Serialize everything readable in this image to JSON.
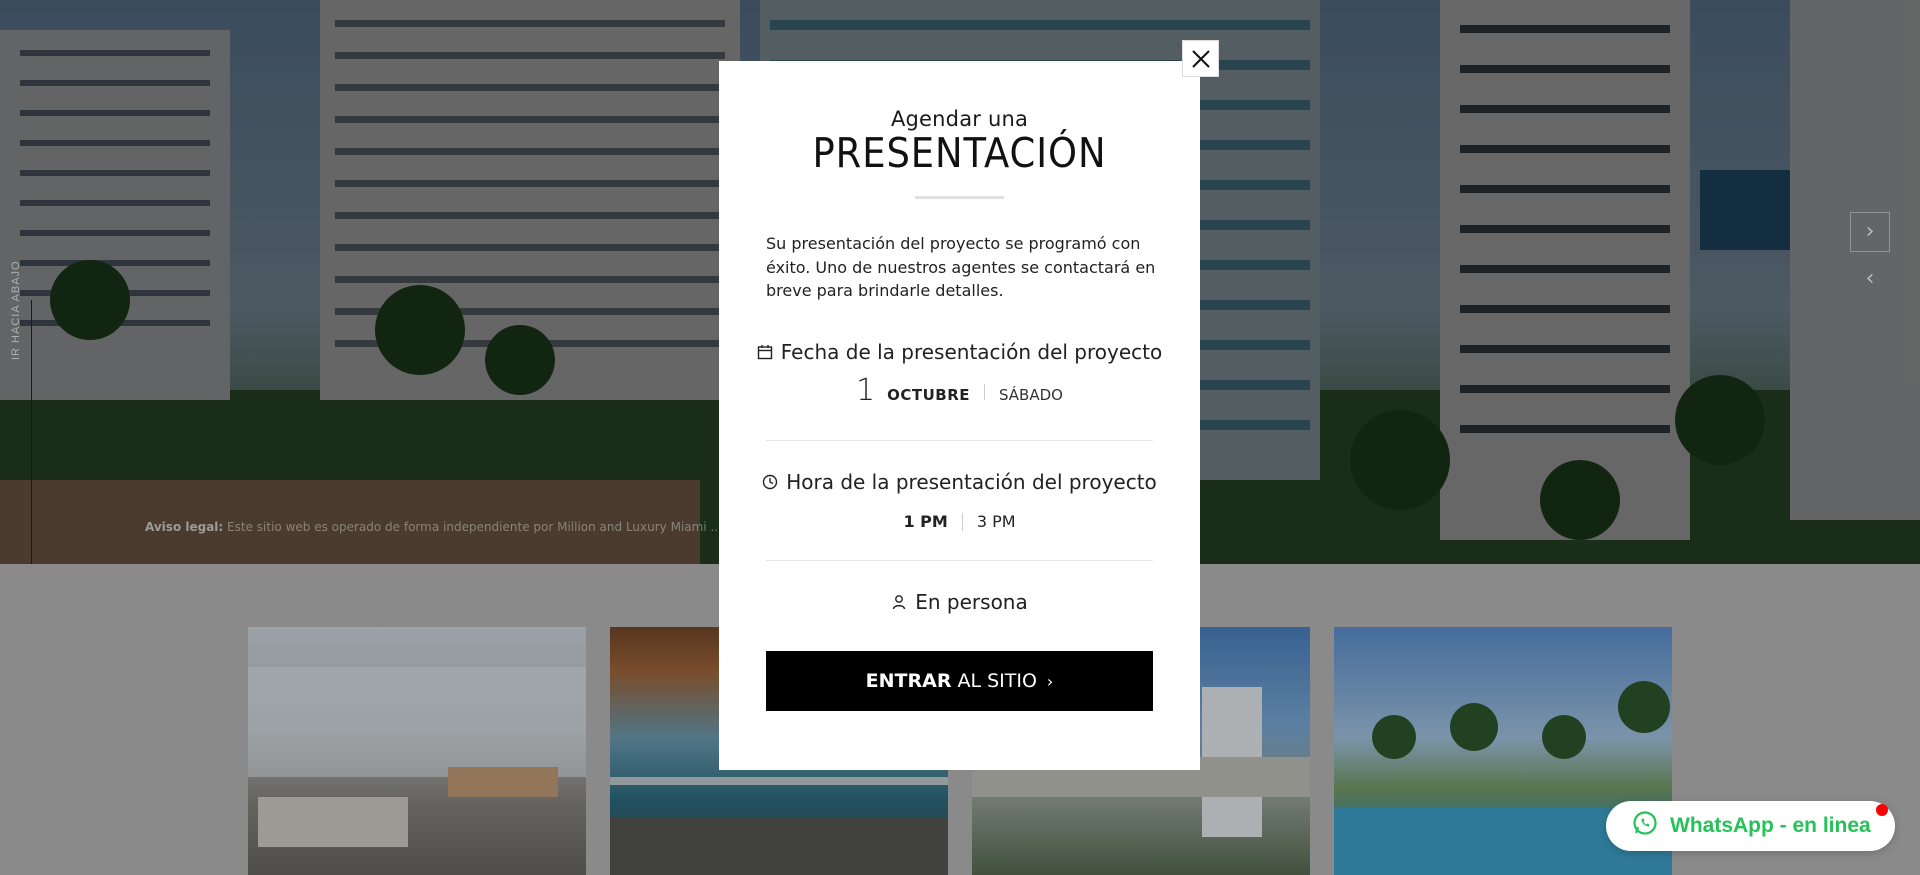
{
  "hero": {
    "disclaimer_label": "Aviso legal:",
    "disclaimer_text": "Este sitio web es operado de forma independiente por Million and Luxury Miami ... con la asociación de propietarios o el edificio",
    "scroll_label": "IR HACIA ABAJO"
  },
  "modal": {
    "subtitle": "Agendar una",
    "title": "PRESENTACIÓN",
    "message": "Su presentación del proyecto se programó con éxito. Uno de nuestros agentes se contactará en breve para brindarle detalles.",
    "date_label": "Fecha de la presentación del proyecto",
    "date_number": "1",
    "date_month": "OCTUBRE",
    "date_day": "SÁBADO",
    "time_label": "Hora de la presentación del proyecto",
    "time_selected": "1 PM",
    "time_other": "3 PM",
    "mode_label": "En persona",
    "cta_bold": "ENTRAR",
    "cta_rest": "AL SITIO"
  },
  "whatsapp": {
    "label": "WhatsApp - en linea"
  },
  "icons": {
    "close": "close-icon",
    "calendar": "calendar-icon",
    "clock": "clock-icon",
    "person": "person-icon",
    "whatsapp": "whatsapp-icon",
    "next": "chevron-right-icon",
    "prev": "chevron-left-icon"
  },
  "colors": {
    "whatsapp_green": "#25c257",
    "cta_bg": "#000000",
    "online_dot": "#ff0000"
  }
}
